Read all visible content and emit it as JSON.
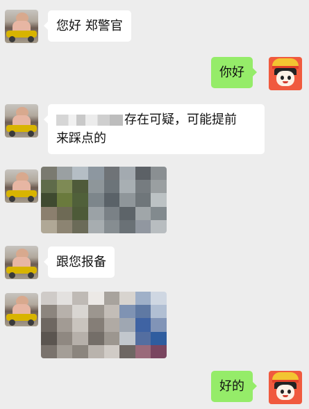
{
  "messages": [
    {
      "side": "left",
      "type": "text",
      "text": "您好 郑警官"
    },
    {
      "side": "right",
      "type": "text",
      "text": "你好"
    },
    {
      "side": "left",
      "type": "text",
      "line1_rest": "存在可疑，可能提前",
      "line2": "来踩点的",
      "redacted": true
    },
    {
      "side": "left",
      "type": "image",
      "description": "pixelated photo"
    },
    {
      "side": "left",
      "type": "text",
      "text": "跟您报备"
    },
    {
      "side": "left",
      "type": "image",
      "description": "pixelated photo"
    },
    {
      "side": "right",
      "type": "text",
      "text": "好的"
    }
  ],
  "avatars": {
    "left": "user-photo-avatar",
    "right": "cartoon-avatar"
  },
  "colors": {
    "background": "#ededed",
    "incoming_bubble": "#ffffff",
    "outgoing_bubble": "#95ec69"
  },
  "image1_palette": [
    "#7a7a70",
    "#9aa0a2",
    "#b5bec5",
    "#8d97a0",
    "#6f7377",
    "#a3aab0",
    "#5c6166",
    "#8a8f92",
    "#5f6b4a",
    "#7e8a55",
    "#4f5a3a",
    "#8e969a",
    "#6c7479",
    "#a8afb3",
    "#767c80",
    "#9a9fa1",
    "#3f4a30",
    "#6a7a3d",
    "#50603a",
    "#7d868b",
    "#5a6268",
    "#8f969a",
    "#6f767a",
    "#bcc2c4",
    "#8b7f6e",
    "#6e6a55",
    "#4d5a38",
    "#9ba2a6",
    "#7a8186",
    "#5d6469",
    "#a0a6a9",
    "#828a8e",
    "#b0a896",
    "#8c8472",
    "#6b6b58",
    "#a7adb0",
    "#868d91",
    "#6a7176",
    "#9197a0",
    "#b8bdc0"
  ],
  "image2_palette": [
    "#cfcbc8",
    "#e3e1df",
    "#bfbab5",
    "#ece9e6",
    "#a8a39d",
    "#d8d4cf",
    "#9fb0c8",
    "#cfd7e2",
    "#8c857e",
    "#b7b1ab",
    "#d9d6d2",
    "#9c968f",
    "#c3bdb7",
    "#7f93b3",
    "#5f79a3",
    "#b1bfd3",
    "#6e6761",
    "#a29b94",
    "#c9c4be",
    "#857e77",
    "#b0aaa4",
    "#9fa7b2",
    "#3f63a3",
    "#8194b7",
    "#5b5550",
    "#8f8881",
    "#b6b0aa",
    "#746e68",
    "#9c968f",
    "#c2c7cd",
    "#546ea0",
    "#2f5d9f",
    "#7a736d",
    "#a49e97",
    "#8b857e",
    "#b9b3ad",
    "#d0cbc6",
    "#6e6763",
    "#9a6a7a",
    "#7a4660"
  ]
}
